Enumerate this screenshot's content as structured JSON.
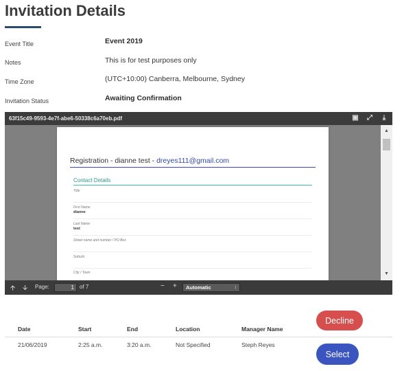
{
  "page": {
    "title": "Invitation Details"
  },
  "details": [
    {
      "label": "Event Title",
      "value": "Event 2019"
    },
    {
      "label": "Notes",
      "value": "This is for test purposes only"
    },
    {
      "label": "Time Zone",
      "value": "(UTC+10:00) Canberra, Melbourne, Sydney"
    },
    {
      "label": "Invitation Status",
      "value": "Awaiting Confirmation"
    }
  ],
  "pdf_viewer": {
    "filename": "63f15c49-9593-4e7f-abe6-50338c6a70eb.pdf",
    "page_label": "Page:",
    "current_page": "1",
    "page_count_text": "of 7",
    "zoom": "Automatic",
    "document": {
      "heading_prefix": "Registration - dianne test - ",
      "heading_email": "dreyes111@gmail.com",
      "section_title": "Contact Details",
      "fields": [
        {
          "label": "Title",
          "value": ""
        },
        {
          "label": "First Name",
          "value": "dianne"
        },
        {
          "label": "Last Name",
          "value": "test"
        },
        {
          "label": "Street name and number / PO Box",
          "value": ""
        },
        {
          "label": "Suburb",
          "value": ""
        },
        {
          "label": "City / Town",
          "value": ""
        }
      ]
    },
    "icons": {
      "prev_page": "arrow-up-icon",
      "next_page": "arrow-down-icon",
      "zoom_out": "minus-icon",
      "zoom_in": "plus-icon",
      "presentation": "presentation-icon",
      "fullscreen": "fullscreen-icon",
      "download": "download-icon"
    }
  },
  "schedule": {
    "headers": [
      "Date",
      "Start",
      "End",
      "Location",
      "Manager Name"
    ],
    "row": [
      "21/06/2019",
      "2:25 a.m.",
      "3:20 a.m.",
      "Not Specified",
      "Steph Reyes"
    ]
  },
  "actions": {
    "decline_label": "Decline",
    "select_label": "Select"
  },
  "colors": {
    "decline": "#d64e4e",
    "select": "#3b55c0",
    "title_rule": "#2a4a6e",
    "contact_accent": "#3dbfa3"
  }
}
